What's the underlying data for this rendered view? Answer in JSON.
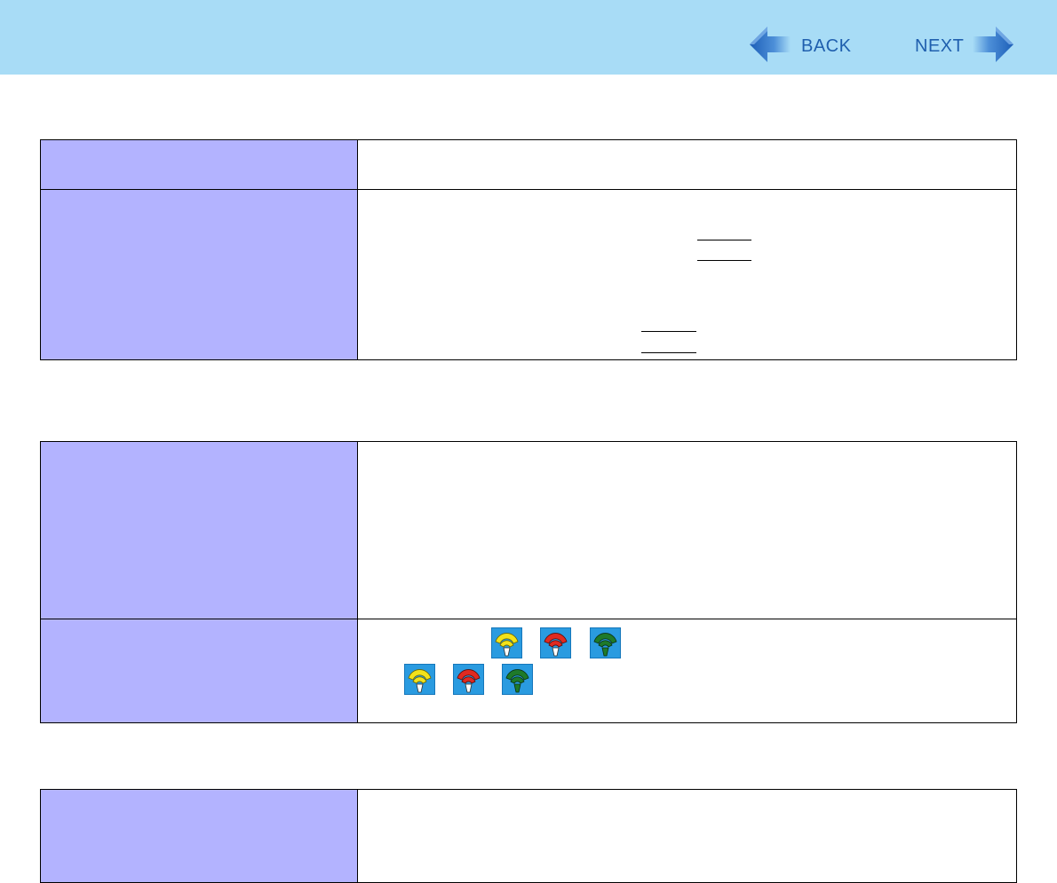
{
  "nav": {
    "back_label": "BACK",
    "next_label": "NEXT"
  },
  "colors": {
    "header_bg": "#a8dcf6",
    "label_cell_bg": "#b3b3ff",
    "nav_text": "#1f5fae",
    "icon_bg": "#2a9be0"
  },
  "tables": [
    {
      "rows": [
        {
          "label": "",
          "value": ""
        },
        {
          "label": "",
          "value": ""
        }
      ]
    },
    {
      "rows": [
        {
          "label": "",
          "value": ""
        },
        {
          "label": "",
          "value": ""
        }
      ]
    },
    {
      "rows": [
        {
          "label": "",
          "value": ""
        }
      ]
    }
  ],
  "wireless_icons": [
    {
      "icon": "wireless-yellow-icon",
      "color": "#f2e21a"
    },
    {
      "icon": "wireless-red-icon",
      "color": "#e02a20"
    },
    {
      "icon": "wireless-green-icon",
      "color": "#1e7a2a"
    }
  ]
}
